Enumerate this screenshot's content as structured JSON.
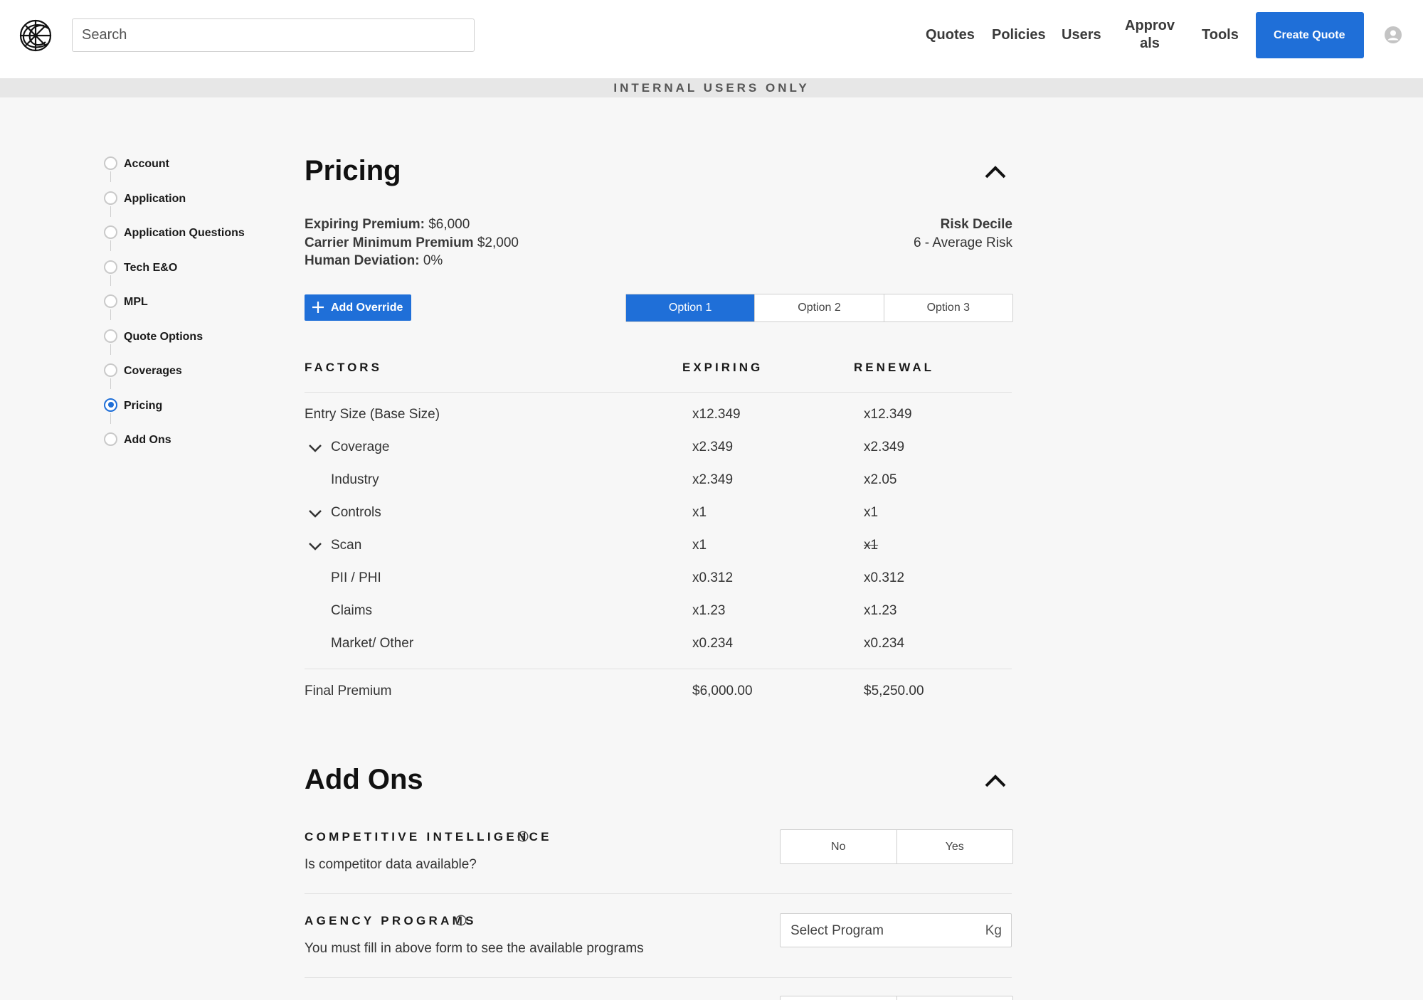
{
  "nav": {
    "search_placeholder": "Search",
    "links": {
      "quotes": "Quotes",
      "policies": "Policies",
      "users": "Users",
      "approvals": "Approv als",
      "tools": "Tools"
    },
    "create_quote": "Create Quote"
  },
  "banner": "INTERNAL USERS ONLY",
  "stepper": [
    {
      "label": "Account",
      "active": false
    },
    {
      "label": "Application",
      "active": false
    },
    {
      "label": "Application Questions",
      "active": false
    },
    {
      "label": "Tech E&O",
      "active": false
    },
    {
      "label": "MPL",
      "active": false
    },
    {
      "label": "Quote Options",
      "active": false
    },
    {
      "label": "Coverages",
      "active": false
    },
    {
      "label": "Pricing",
      "active": true
    },
    {
      "label": "Add Ons",
      "active": false
    }
  ],
  "pricing": {
    "title": "Pricing",
    "meta": [
      {
        "label": "Expiring Premium:",
        "value": "$6,000"
      },
      {
        "label": "Carrier Minimum Premium",
        "value": "$2,000"
      },
      {
        "label": "Human Deviation:",
        "value": "0%"
      }
    ],
    "risk_label": "Risk Decile",
    "risk_value": "6 - Average Risk",
    "add_override": "Add Override",
    "options": [
      "Option 1",
      "Option 2",
      "Option 3"
    ],
    "selected_option": "Option 1",
    "columns": {
      "factors": "FACTORS",
      "expiring": "EXPIRING",
      "renewal": "RENEWAL"
    },
    "rows": [
      {
        "name": "Entry Size (Base Size)",
        "expiring": "x12.349",
        "renewal": "x12.349"
      },
      {
        "name": "Coverage",
        "expiring": "x2.349",
        "renewal": "x2.349"
      },
      {
        "name": "Industry",
        "expiring": "x2.349",
        "renewal": "x2.05"
      },
      {
        "name": "Controls",
        "expiring": "x1",
        "renewal": "x1"
      },
      {
        "name": "Scan",
        "expiring": "x1",
        "renewal": "x1"
      },
      {
        "name": "PII / PHI",
        "expiring": "x0.312",
        "renewal": "x0.312"
      },
      {
        "name": "Claims",
        "expiring": "x1.23",
        "renewal": "x1.23"
      },
      {
        "name": "Market/ Other",
        "expiring": "x0.234",
        "renewal": "x0.234"
      }
    ],
    "final": {
      "name": "Final Premium",
      "expiring": "$6,000.00",
      "renewal": "$5,250.00"
    }
  },
  "addons": {
    "title": "Add Ons",
    "competitive": {
      "heading": "COMPETITIVE INTELLIGENCE",
      "description": "Is competitor data available?",
      "options": [
        "No",
        "Yes"
      ]
    },
    "agency": {
      "heading": "AGENCY PROGRAMS",
      "description": "You must fill in above form to see the available programs",
      "select_placeholder": "Select Program",
      "select_unit": "Kg"
    }
  }
}
